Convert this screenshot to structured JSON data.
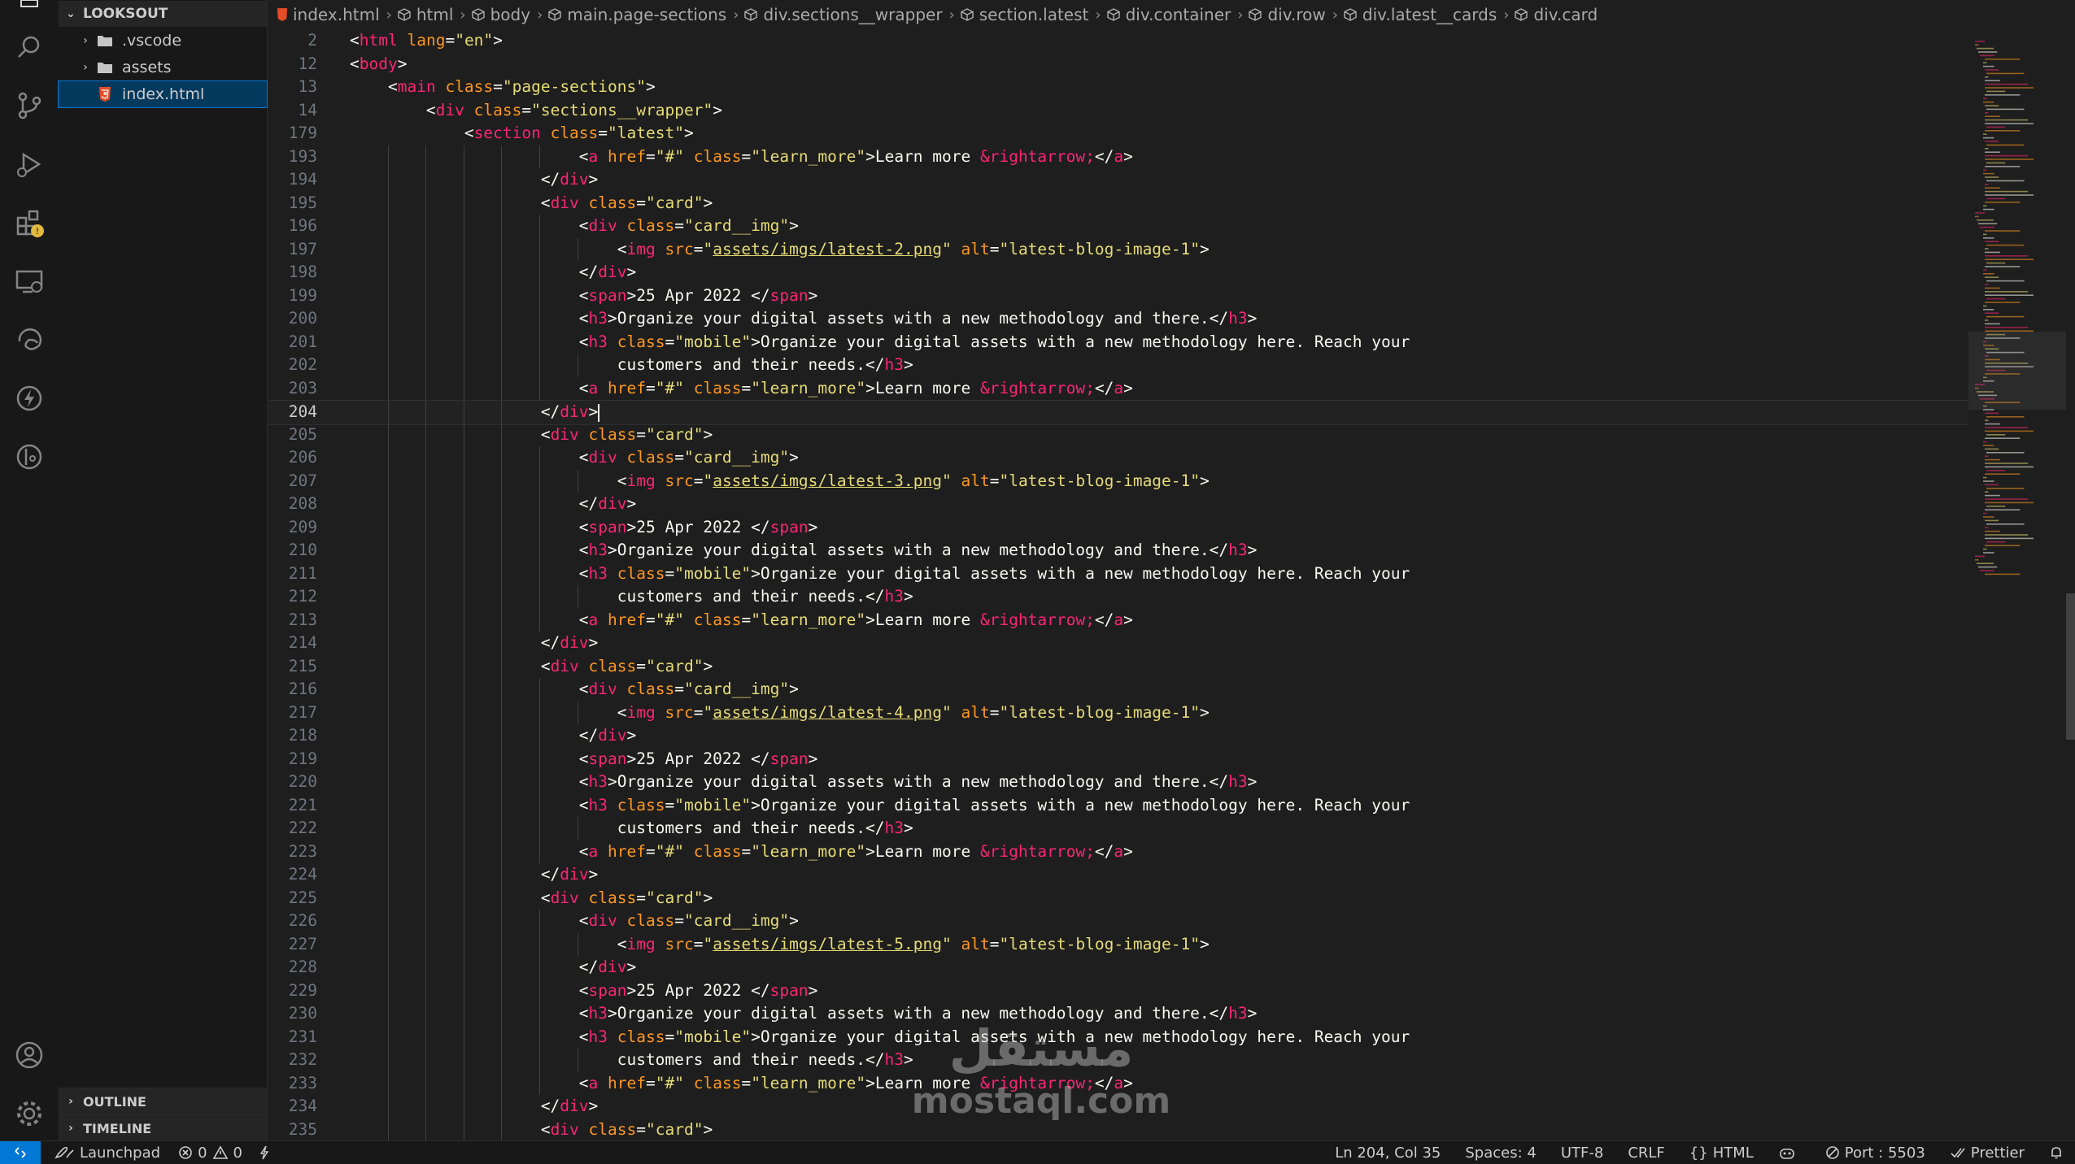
{
  "sidebar": {
    "section_title": "LOOKSOUT",
    "items": [
      {
        "label": ".vscode",
        "type": "folder"
      },
      {
        "label": "assets",
        "type": "folder"
      },
      {
        "label": "index.html",
        "type": "file"
      }
    ],
    "outline_label": "OUTLINE",
    "timeline_label": "TIMELINE"
  },
  "breadcrumb": [
    "index.html",
    "html",
    "body",
    "main.page-sections",
    "div.sections__wrapper",
    "section.latest",
    "div.container",
    "div.row",
    "div.latest__cards",
    "div.card"
  ],
  "editor": {
    "current_line": "204",
    "lines": [
      {
        "n": "2",
        "code": "<html lang=\"en\">"
      },
      {
        "n": "12",
        "code": "<body>"
      },
      {
        "n": "13",
        "code": "    <main class=\"page-sections\">"
      },
      {
        "n": "14",
        "code": "        <div class=\"sections__wrapper\">"
      },
      {
        "n": "179",
        "code": "            <section class=\"latest\">"
      },
      {
        "n": "193",
        "code": "                        <a href=\"#\" class=\"learn_more\">Learn more &rightarrow;</a>"
      },
      {
        "n": "194",
        "code": "                    </div>"
      },
      {
        "n": "195",
        "code": "                    <div class=\"card\">"
      },
      {
        "n": "196",
        "code": "                        <div class=\"card__img\">"
      },
      {
        "n": "197",
        "code": "                            <img src=\"assets/imgs/latest-2.png\" alt=\"latest-blog-image-1\">"
      },
      {
        "n": "198",
        "code": "                        </div>"
      },
      {
        "n": "199",
        "code": "                        <span>25 Apr 2022 </span>"
      },
      {
        "n": "200",
        "code": "                        <h3>Organize your digital assets with a new methodology and there.</h3>"
      },
      {
        "n": "201",
        "code": "                        <h3 class=\"mobile\">Organize your digital assets with a new methodology here. Reach your"
      },
      {
        "n": "202",
        "code": "                            customers and their needs.</h3>"
      },
      {
        "n": "203",
        "code": "                        <a href=\"#\" class=\"learn_more\">Learn more &rightarrow;</a>"
      },
      {
        "n": "204",
        "code": "                    </div>"
      },
      {
        "n": "205",
        "code": "                    <div class=\"card\">"
      },
      {
        "n": "206",
        "code": "                        <div class=\"card__img\">"
      },
      {
        "n": "207",
        "code": "                            <img src=\"assets/imgs/latest-3.png\" alt=\"latest-blog-image-1\">"
      },
      {
        "n": "208",
        "code": "                        </div>"
      },
      {
        "n": "209",
        "code": "                        <span>25 Apr 2022 </span>"
      },
      {
        "n": "210",
        "code": "                        <h3>Organize your digital assets with a new methodology and there.</h3>"
      },
      {
        "n": "211",
        "code": "                        <h3 class=\"mobile\">Organize your digital assets with a new methodology here. Reach your"
      },
      {
        "n": "212",
        "code": "                            customers and their needs.</h3>"
      },
      {
        "n": "213",
        "code": "                        <a href=\"#\" class=\"learn_more\">Learn more &rightarrow;</a>"
      },
      {
        "n": "214",
        "code": "                    </div>"
      },
      {
        "n": "215",
        "code": "                    <div class=\"card\">"
      },
      {
        "n": "216",
        "code": "                        <div class=\"card__img\">"
      },
      {
        "n": "217",
        "code": "                            <img src=\"assets/imgs/latest-4.png\" alt=\"latest-blog-image-1\">"
      },
      {
        "n": "218",
        "code": "                        </div>"
      },
      {
        "n": "219",
        "code": "                        <span>25 Apr 2022 </span>"
      },
      {
        "n": "220",
        "code": "                        <h3>Organize your digital assets with a new methodology and there.</h3>"
      },
      {
        "n": "221",
        "code": "                        <h3 class=\"mobile\">Organize your digital assets with a new methodology here. Reach your"
      },
      {
        "n": "222",
        "code": "                            customers and their needs.</h3>"
      },
      {
        "n": "223",
        "code": "                        <a href=\"#\" class=\"learn_more\">Learn more &rightarrow;</a>"
      },
      {
        "n": "224",
        "code": "                    </div>"
      },
      {
        "n": "225",
        "code": "                    <div class=\"card\">"
      },
      {
        "n": "226",
        "code": "                        <div class=\"card__img\">"
      },
      {
        "n": "227",
        "code": "                            <img src=\"assets/imgs/latest-5.png\" alt=\"latest-blog-image-1\">"
      },
      {
        "n": "228",
        "code": "                        </div>"
      },
      {
        "n": "229",
        "code": "                        <span>25 Apr 2022 </span>"
      },
      {
        "n": "230",
        "code": "                        <h3>Organize your digital assets with a new methodology and there.</h3>"
      },
      {
        "n": "231",
        "code": "                        <h3 class=\"mobile\">Organize your digital assets with a new methodology here. Reach your"
      },
      {
        "n": "232",
        "code": "                            customers and their needs.</h3>"
      },
      {
        "n": "233",
        "code": "                        <a href=\"#\" class=\"learn_more\">Learn more &rightarrow;</a>"
      },
      {
        "n": "234",
        "code": "                    </div>"
      },
      {
        "n": "235",
        "code": "                    <div class=\"card\">"
      }
    ]
  },
  "statusbar": {
    "launchpad": "Launchpad",
    "errors": "0",
    "warnings": "0",
    "position": "Ln 204, Col 35",
    "spaces": "Spaces: 4",
    "encoding": "UTF-8",
    "eol": "CRLF",
    "language": "HTML",
    "port": "Port : 5503",
    "prettier": "Prettier"
  },
  "watermark": {
    "arabic": "مستقل",
    "latin": "mostaql.com"
  },
  "colors": {
    "background": "#1e1e1e",
    "sidebar": "#181818",
    "selection": "#04395e",
    "accent": "#0078d4",
    "tag": "#f92672",
    "attribute": "#fd971f",
    "string": "#e6db74",
    "text": "#f8f8f2",
    "warning_badge": "#e2b93d"
  }
}
